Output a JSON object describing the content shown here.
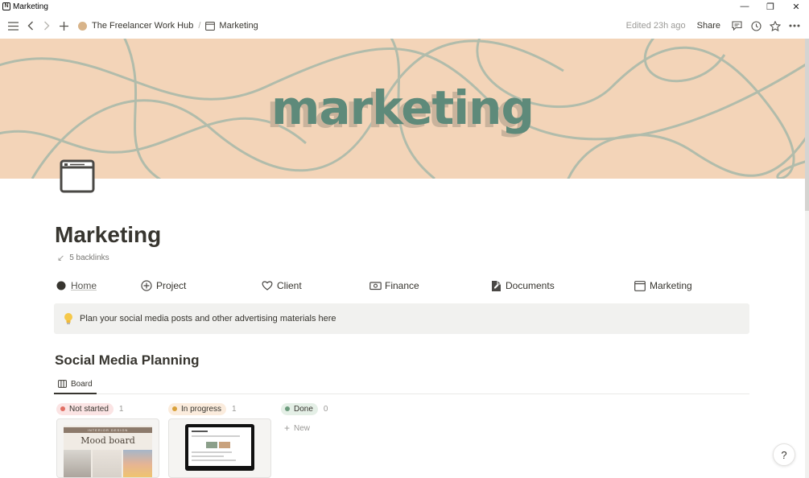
{
  "window": {
    "title": "Marketing",
    "app_icon": "N",
    "controls": {
      "minimize": "—",
      "restore": "❐",
      "close": "✕"
    }
  },
  "topbar": {
    "icons": [
      "hamburger-menu-icon",
      "back-arrow-icon",
      "forward-arrow-icon",
      "plus-icon"
    ],
    "breadcrumb": [
      {
        "label": "The Freelancer Work Hub",
        "icon": "avatar"
      },
      {
        "label": "Marketing",
        "icon": "browser-window-icon"
      }
    ],
    "breadcrumb_separator": "/",
    "edited": "Edited 23h ago",
    "share_label": "Share",
    "right_icons": [
      "comment-icon",
      "history-clock-icon",
      "star-icon",
      "more-dots-icon"
    ]
  },
  "cover": {
    "word": "marketing",
    "background_color": "#f3d4b8",
    "text_color": "#5e8a7a",
    "line_color": "#9bb4a7"
  },
  "page": {
    "icon": "browser-window-icon",
    "title": "Marketing",
    "backlinks": "5 backlinks"
  },
  "nav": [
    {
      "label": "Home",
      "icon": "filled-circle-icon"
    },
    {
      "label": "Project",
      "icon": "circle-plus-icon"
    },
    {
      "label": "Client",
      "icon": "heart-chat-icon"
    },
    {
      "label": "Finance",
      "icon": "money-icon"
    },
    {
      "label": "Documents",
      "icon": "document-pen-icon"
    },
    {
      "label": "Marketing",
      "icon": "browser-window-icon"
    }
  ],
  "callout": {
    "icon": "lightbulb-icon",
    "text": "Plan your social media posts and other advertising materials here"
  },
  "section": {
    "title": "Social Media Planning",
    "view_tab": {
      "label": "Board",
      "icon": "board-icon"
    }
  },
  "board": {
    "columns": [
      {
        "label": "Not started",
        "count": "1",
        "pill_bg": "#fbe4e4",
        "dot": "#e16f64"
      },
      {
        "label": "In progress",
        "count": "1",
        "pill_bg": "#fbecdd",
        "dot": "#d9a13b"
      },
      {
        "label": "Done",
        "count": "0",
        "pill_bg": "#e4efe6",
        "dot": "#6c9b7d"
      }
    ],
    "cards": {
      "mood_board": {
        "banner": "INTERIOR DESIGN",
        "title": "Mood board"
      }
    },
    "new_label": "New"
  },
  "help": {
    "label": "?"
  }
}
